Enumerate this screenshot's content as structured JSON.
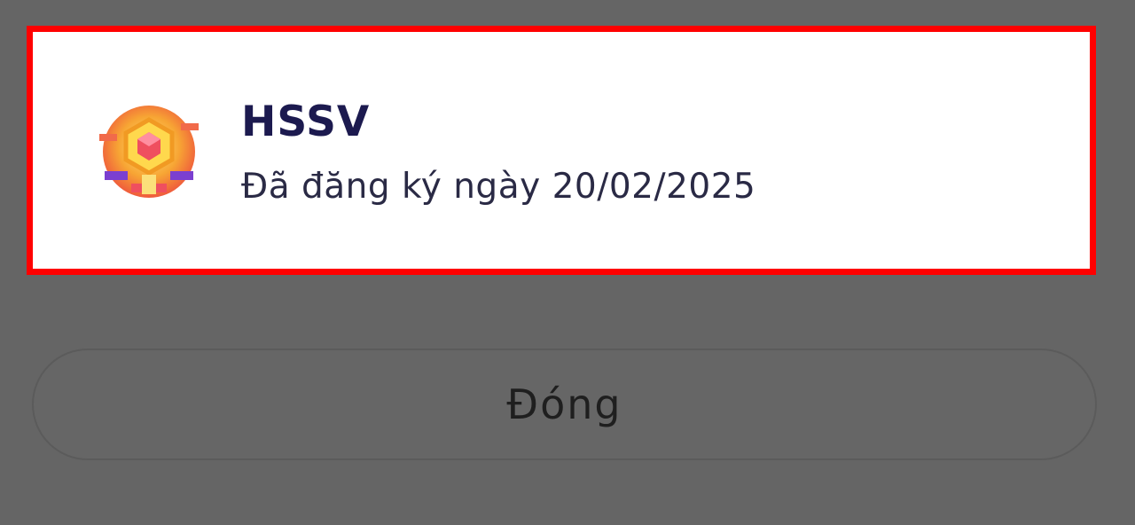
{
  "dialog": {
    "package": {
      "icon": "hssv-badge-icon",
      "title": "HSSV",
      "subtitle": "Đã đăng ký ngày 20/02/2025"
    },
    "close_label": "Đóng"
  },
  "colors": {
    "overlay": "#656565",
    "highlight": "#ff0000",
    "card": "#ffffff",
    "title": "#1c1a4f"
  }
}
